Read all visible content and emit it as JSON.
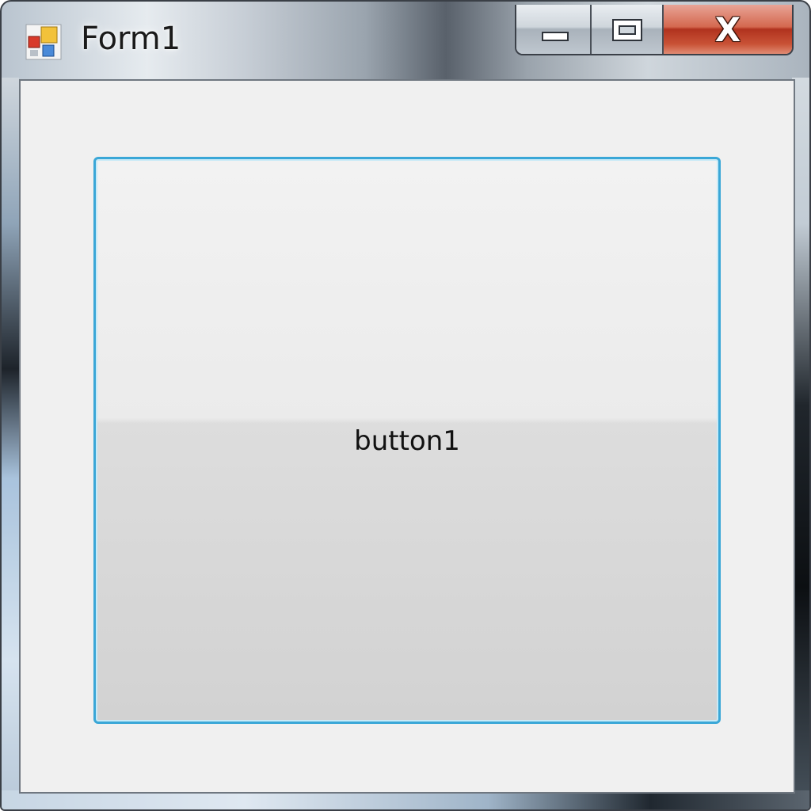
{
  "window": {
    "title": "Form1",
    "app_icon": "windows-form-icon",
    "controls": {
      "minimize_icon": "minimize-icon",
      "maximize_icon": "maximize-icon",
      "close_label": "X"
    }
  },
  "form": {
    "button1_label": "button1"
  },
  "colors": {
    "button_focus_border": "#3aa7d7",
    "client_background": "#f0f0f0",
    "close_button": "#c9442a"
  }
}
